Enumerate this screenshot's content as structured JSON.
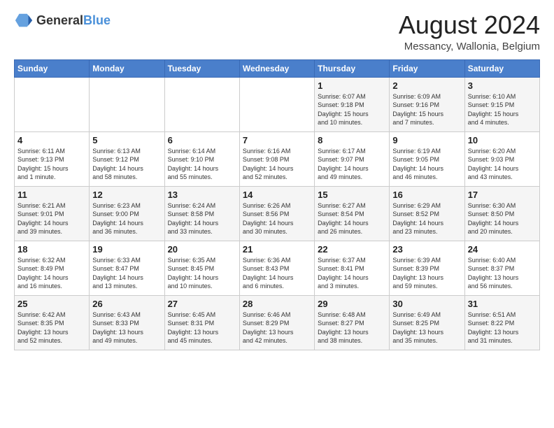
{
  "header": {
    "logo_general": "General",
    "logo_blue": "Blue",
    "month_title": "August 2024",
    "location": "Messancy, Wallonia, Belgium"
  },
  "days_of_week": [
    "Sunday",
    "Monday",
    "Tuesday",
    "Wednesday",
    "Thursday",
    "Friday",
    "Saturday"
  ],
  "weeks": [
    [
      {
        "day": "",
        "info": ""
      },
      {
        "day": "",
        "info": ""
      },
      {
        "day": "",
        "info": ""
      },
      {
        "day": "",
        "info": ""
      },
      {
        "day": "1",
        "info": "Sunrise: 6:07 AM\nSunset: 9:18 PM\nDaylight: 15 hours\nand 10 minutes."
      },
      {
        "day": "2",
        "info": "Sunrise: 6:09 AM\nSunset: 9:16 PM\nDaylight: 15 hours\nand 7 minutes."
      },
      {
        "day": "3",
        "info": "Sunrise: 6:10 AM\nSunset: 9:15 PM\nDaylight: 15 hours\nand 4 minutes."
      }
    ],
    [
      {
        "day": "4",
        "info": "Sunrise: 6:11 AM\nSunset: 9:13 PM\nDaylight: 15 hours\nand 1 minute."
      },
      {
        "day": "5",
        "info": "Sunrise: 6:13 AM\nSunset: 9:12 PM\nDaylight: 14 hours\nand 58 minutes."
      },
      {
        "day": "6",
        "info": "Sunrise: 6:14 AM\nSunset: 9:10 PM\nDaylight: 14 hours\nand 55 minutes."
      },
      {
        "day": "7",
        "info": "Sunrise: 6:16 AM\nSunset: 9:08 PM\nDaylight: 14 hours\nand 52 minutes."
      },
      {
        "day": "8",
        "info": "Sunrise: 6:17 AM\nSunset: 9:07 PM\nDaylight: 14 hours\nand 49 minutes."
      },
      {
        "day": "9",
        "info": "Sunrise: 6:19 AM\nSunset: 9:05 PM\nDaylight: 14 hours\nand 46 minutes."
      },
      {
        "day": "10",
        "info": "Sunrise: 6:20 AM\nSunset: 9:03 PM\nDaylight: 14 hours\nand 43 minutes."
      }
    ],
    [
      {
        "day": "11",
        "info": "Sunrise: 6:21 AM\nSunset: 9:01 PM\nDaylight: 14 hours\nand 39 minutes."
      },
      {
        "day": "12",
        "info": "Sunrise: 6:23 AM\nSunset: 9:00 PM\nDaylight: 14 hours\nand 36 minutes."
      },
      {
        "day": "13",
        "info": "Sunrise: 6:24 AM\nSunset: 8:58 PM\nDaylight: 14 hours\nand 33 minutes."
      },
      {
        "day": "14",
        "info": "Sunrise: 6:26 AM\nSunset: 8:56 PM\nDaylight: 14 hours\nand 30 minutes."
      },
      {
        "day": "15",
        "info": "Sunrise: 6:27 AM\nSunset: 8:54 PM\nDaylight: 14 hours\nand 26 minutes."
      },
      {
        "day": "16",
        "info": "Sunrise: 6:29 AM\nSunset: 8:52 PM\nDaylight: 14 hours\nand 23 minutes."
      },
      {
        "day": "17",
        "info": "Sunrise: 6:30 AM\nSunset: 8:50 PM\nDaylight: 14 hours\nand 20 minutes."
      }
    ],
    [
      {
        "day": "18",
        "info": "Sunrise: 6:32 AM\nSunset: 8:49 PM\nDaylight: 14 hours\nand 16 minutes."
      },
      {
        "day": "19",
        "info": "Sunrise: 6:33 AM\nSunset: 8:47 PM\nDaylight: 14 hours\nand 13 minutes."
      },
      {
        "day": "20",
        "info": "Sunrise: 6:35 AM\nSunset: 8:45 PM\nDaylight: 14 hours\nand 10 minutes."
      },
      {
        "day": "21",
        "info": "Sunrise: 6:36 AM\nSunset: 8:43 PM\nDaylight: 14 hours\nand 6 minutes."
      },
      {
        "day": "22",
        "info": "Sunrise: 6:37 AM\nSunset: 8:41 PM\nDaylight: 14 hours\nand 3 minutes."
      },
      {
        "day": "23",
        "info": "Sunrise: 6:39 AM\nSunset: 8:39 PM\nDaylight: 13 hours\nand 59 minutes."
      },
      {
        "day": "24",
        "info": "Sunrise: 6:40 AM\nSunset: 8:37 PM\nDaylight: 13 hours\nand 56 minutes."
      }
    ],
    [
      {
        "day": "25",
        "info": "Sunrise: 6:42 AM\nSunset: 8:35 PM\nDaylight: 13 hours\nand 52 minutes."
      },
      {
        "day": "26",
        "info": "Sunrise: 6:43 AM\nSunset: 8:33 PM\nDaylight: 13 hours\nand 49 minutes."
      },
      {
        "day": "27",
        "info": "Sunrise: 6:45 AM\nSunset: 8:31 PM\nDaylight: 13 hours\nand 45 minutes."
      },
      {
        "day": "28",
        "info": "Sunrise: 6:46 AM\nSunset: 8:29 PM\nDaylight: 13 hours\nand 42 minutes."
      },
      {
        "day": "29",
        "info": "Sunrise: 6:48 AM\nSunset: 8:27 PM\nDaylight: 13 hours\nand 38 minutes."
      },
      {
        "day": "30",
        "info": "Sunrise: 6:49 AM\nSunset: 8:25 PM\nDaylight: 13 hours\nand 35 minutes."
      },
      {
        "day": "31",
        "info": "Sunrise: 6:51 AM\nSunset: 8:22 PM\nDaylight: 13 hours\nand 31 minutes."
      }
    ]
  ]
}
